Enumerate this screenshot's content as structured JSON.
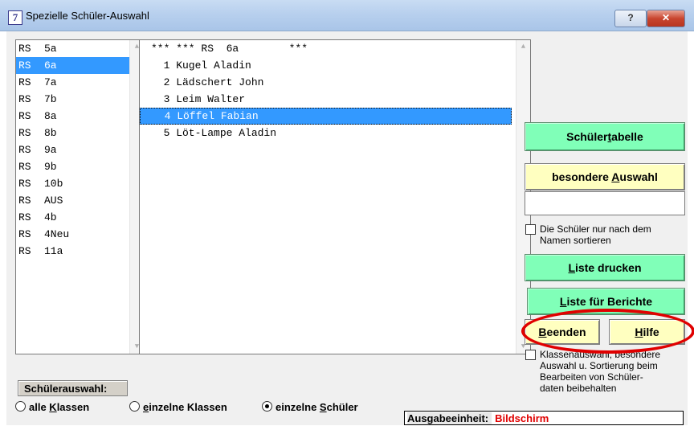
{
  "window": {
    "title": "Spezielle Schüler-Auswahl",
    "icon_glyph": "7",
    "help_label": "?",
    "close_label": "✕"
  },
  "class_list": [
    {
      "school": "RS",
      "class": "5a",
      "selected": false
    },
    {
      "school": "RS",
      "class": "6a",
      "selected": true
    },
    {
      "school": "RS",
      "class": "7a",
      "selected": false
    },
    {
      "school": "RS",
      "class": "7b",
      "selected": false
    },
    {
      "school": "RS",
      "class": "8a",
      "selected": false
    },
    {
      "school": "RS",
      "class": "8b",
      "selected": false
    },
    {
      "school": "RS",
      "class": "9a",
      "selected": false
    },
    {
      "school": "RS",
      "class": "9b",
      "selected": false
    },
    {
      "school": "RS",
      "class": "10b",
      "selected": false
    },
    {
      "school": "RS",
      "class": "AUS",
      "selected": false
    },
    {
      "school": "RS",
      "class": "4b",
      "selected": false
    },
    {
      "school": "RS",
      "class": "4Neu",
      "selected": false
    },
    {
      "school": "RS",
      "class": "11a",
      "selected": false
    }
  ],
  "student_list": {
    "header": "*** *** RS  6a        ***",
    "rows": [
      {
        "text": "  1 Kugel Aladin",
        "selected": false
      },
      {
        "text": "  2 Lädschert John",
        "selected": false
      },
      {
        "text": "  3 Leim Walter",
        "selected": false
      },
      {
        "text": "  4 Löffel Fabian",
        "selected": true
      },
      {
        "text": "  5 Löt-Lampe Aladin",
        "selected": false
      }
    ]
  },
  "buttons": {
    "schuelertabelle": {
      "pre": "Schüler",
      "ul": "t",
      "post": "abelle"
    },
    "besondere_auswahl": {
      "pre": "besondere ",
      "ul": "A",
      "post": "uswahl"
    },
    "liste_drucken": {
      "pre": "",
      "ul": "L",
      "post": "iste drucken"
    },
    "liste_berichte": {
      "pre": "",
      "ul": "L",
      "post": "iste für Berichte"
    },
    "beenden": {
      "pre": "",
      "ul": "B",
      "post": "eenden"
    },
    "hilfe": {
      "pre": "",
      "ul": "H",
      "post": "ilfe"
    }
  },
  "checkboxes": {
    "sort_by_name": {
      "label_line1": "Die Schüler nur nach dem",
      "label_line2": "Namen sortieren",
      "checked": false
    },
    "keep_selection": {
      "label_line1": "Klassenauswahl, besondere",
      "label_line2": "Auswahl u. Sortierung beim",
      "label_line3": "Bearbeiten von Schüler-",
      "label_line4": "daten beibehalten",
      "checked": false
    }
  },
  "selection": {
    "label": "Schülerauswahl:",
    "options": [
      {
        "pre": "alle ",
        "ul": "K",
        "post": "lassen",
        "checked": false
      },
      {
        "pre": "",
        "ul": "e",
        "post": "inzelne Klassen",
        "checked": false
      },
      {
        "pre": "einzelne ",
        "ul": "S",
        "post": "chüler",
        "checked": true
      }
    ]
  },
  "output_unit": {
    "label": "Ausgabeeinheit:",
    "value": "Bildschirm"
  },
  "colors": {
    "accent_green": "#80ffb8",
    "accent_yellow": "#ffffc0",
    "highlight": "#e00000",
    "selection_blue": "#3399ff"
  }
}
